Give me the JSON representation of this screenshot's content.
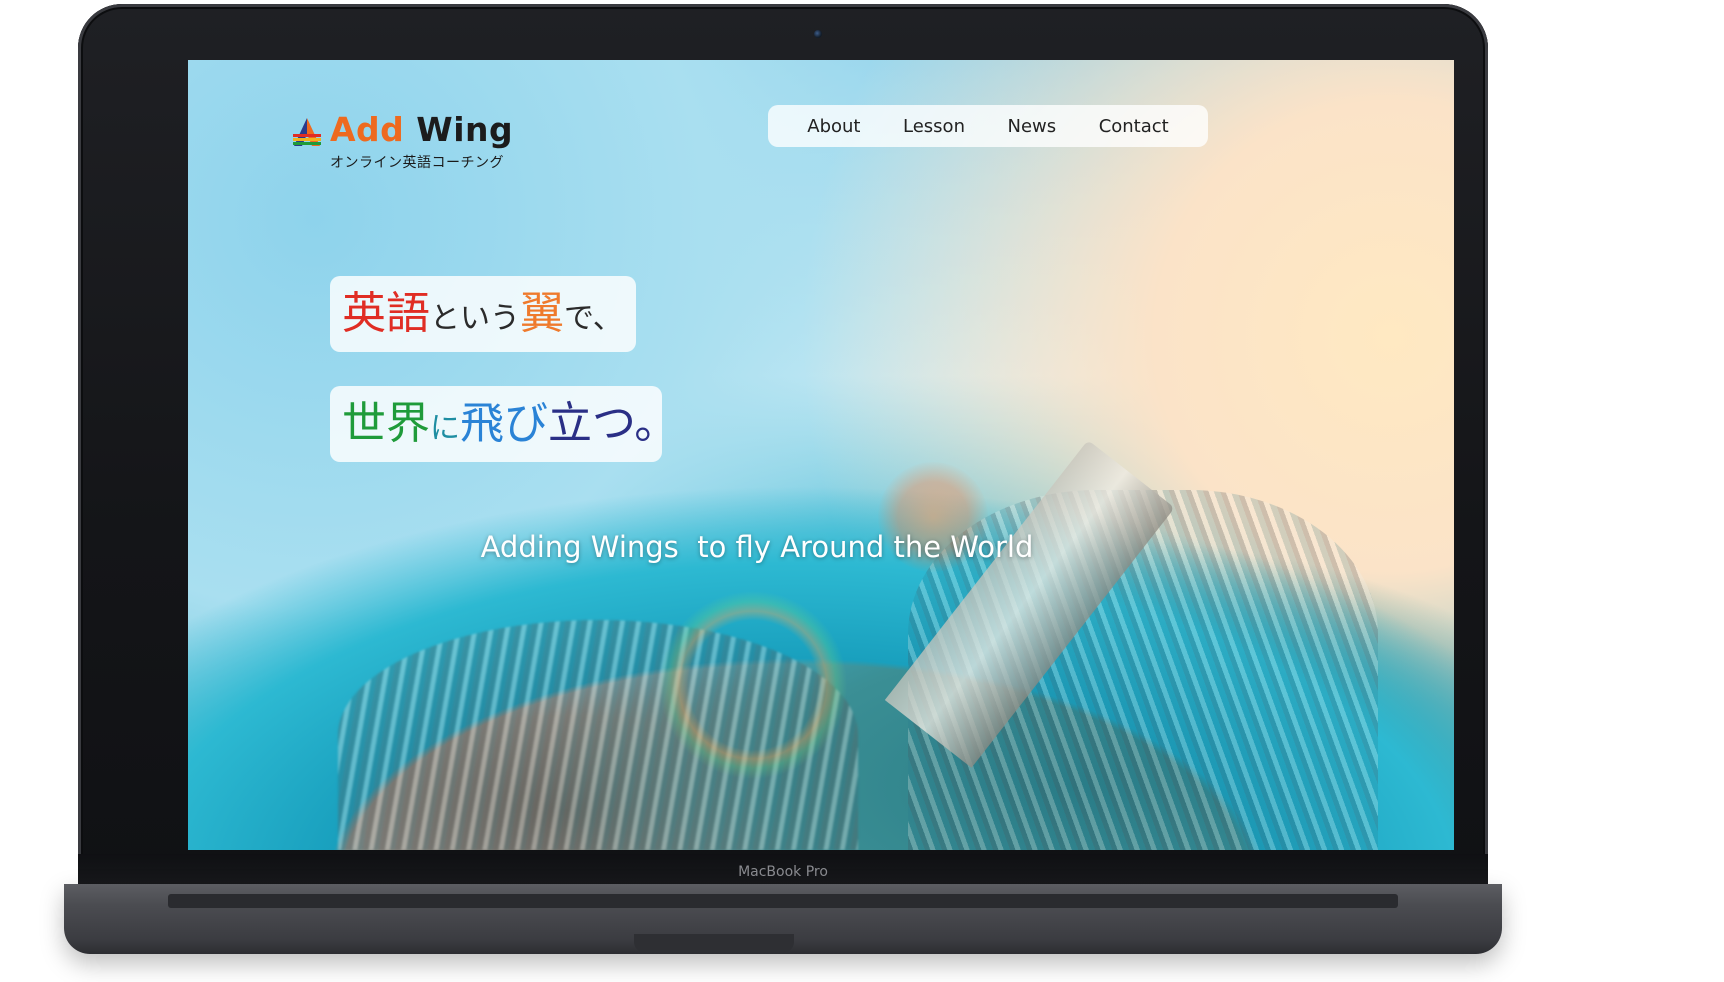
{
  "device": {
    "brand_label": "MacBook Pro"
  },
  "site": {
    "logo": {
      "add": "Add",
      "wing": "Wing",
      "subtitle": "オンライン英語コーチング"
    },
    "nav": [
      "About",
      "Lesson",
      "News",
      "Contact"
    ],
    "hero": {
      "line1": {
        "a": "英語",
        "b": "という",
        "c": "翼",
        "d": "で、"
      },
      "line2": {
        "a": "世界",
        "b": "に",
        "c": "飛び",
        "d": "立つ。"
      },
      "tagline": "Adding Wings  to fly Around the World"
    }
  },
  "colors": {
    "logo_orange": "#ee6a1f",
    "headline_red": "#e02d24",
    "headline_orange": "#ef7a2c",
    "headline_green": "#1f9b3a",
    "headline_blue": "#2a83d6",
    "headline_navy": "#2a2f86"
  }
}
